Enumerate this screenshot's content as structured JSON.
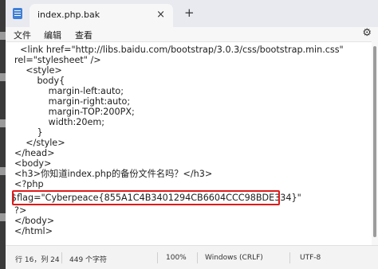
{
  "window": {
    "tab_title": "index.php.bak",
    "tab_close": "×",
    "tab_add": "+"
  },
  "menu": {
    "file": "文件",
    "edit": "编辑",
    "view": "查看",
    "settings_icon": "⚙"
  },
  "editor": {
    "lines": [
      "  <link href=\"http://libs.baidu.com/bootstrap/3.0.3/css/bootstrap.min.css\"",
      "rel=\"stylesheet\" />",
      "    <style>",
      "        body{",
      "            margin-left:auto;",
      "            margin-right:auto;",
      "            margin-TOP:200PX;",
      "            width:20em;",
      "        }",
      "    </style>",
      "</head>",
      "<body>",
      "<h3>你知道index.php的备份文件名吗？</h3>",
      "<?php",
      "$flag=\"Cyberpeace{855A1C4B3401294CB6604CCC98BDE334}\"",
      "?>",
      "</body>",
      "</html>"
    ]
  },
  "status": {
    "position": "行 16，列 24",
    "chars": "449 个字符",
    "zoom": "100%",
    "line_ending": "Windows (CRLF)",
    "encoding": "UTF-8"
  }
}
